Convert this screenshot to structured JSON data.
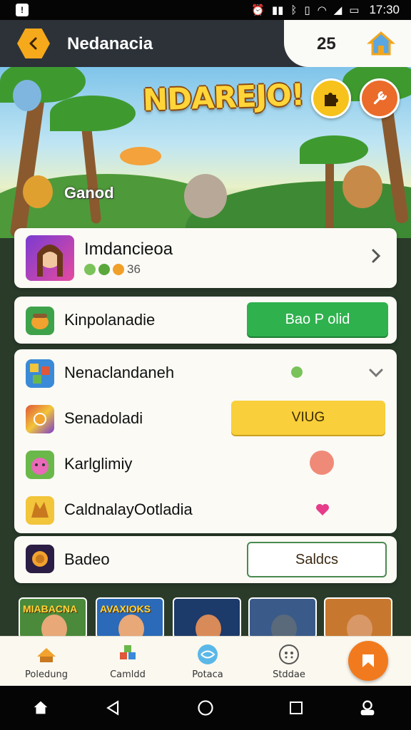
{
  "status_bar": {
    "time": "17:30"
  },
  "header": {
    "title": "Nedanacia",
    "count": "25"
  },
  "banner": {
    "title": "NDAREJO!",
    "subtitle": "Ganod"
  },
  "featured": {
    "name": "Imdancieoa",
    "meta_value": "36"
  },
  "row2": {
    "name": "Kinpolanadie",
    "button": "Bao P olid"
  },
  "list": {
    "items": [
      {
        "name": "Nenaclandaneh",
        "icon_color": "#3a8ad8"
      },
      {
        "name": "Senadoladi",
        "button": "VIUG",
        "icon_color": "#e0573a"
      },
      {
        "name": "Karlglimiy",
        "icon_color": "#6bb84a"
      },
      {
        "name": "CaldnalayOotladia",
        "icon_color": "#f2c53a"
      }
    ]
  },
  "row_last": {
    "name": "Badeo",
    "button": "Saldcs"
  },
  "thumbs": [
    {
      "label": "MIABACNA"
    },
    {
      "label": "AVAXIOKS"
    },
    {
      "label": ""
    },
    {
      "label": ""
    },
    {
      "label": ""
    }
  ],
  "tabs": [
    {
      "label": "Poledung",
      "icon": "hat-icon"
    },
    {
      "label": "Camldd",
      "icon": "blocks-icon"
    },
    {
      "label": "Potaca",
      "icon": "globe-icon"
    },
    {
      "label": "Stddae",
      "icon": "face-icon"
    }
  ],
  "colors": {
    "accent_orange": "#f27a1e",
    "green": "#2fb14e",
    "yellow": "#f9cf3b",
    "header_dark": "#2c3238"
  }
}
